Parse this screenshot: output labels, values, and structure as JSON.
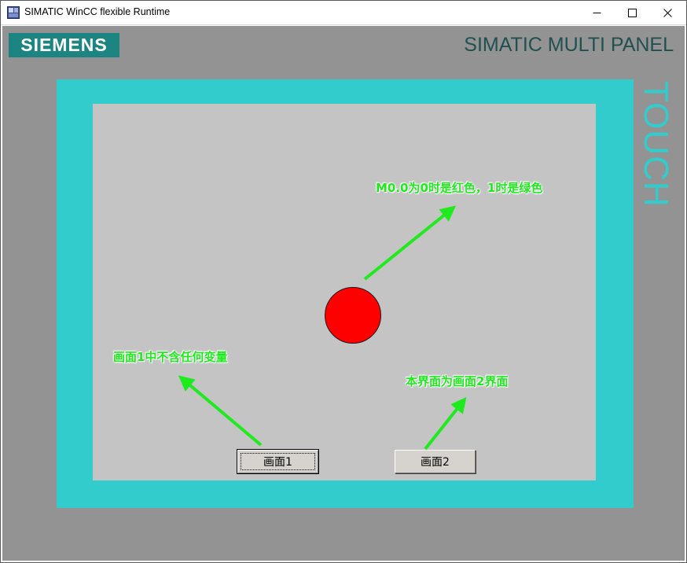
{
  "window": {
    "title": "SIMATIC WinCC flexible Runtime",
    "controls": [
      "minimize-icon",
      "maximize-icon",
      "close-icon"
    ]
  },
  "panel": {
    "brand": "SIEMENS",
    "model": "SIMATIC MULTI PANEL",
    "side_label": "TOUCH",
    "colors": {
      "bezel": "#939393",
      "frame": "#33cccc",
      "screen": "#c4c4c4",
      "logo": "#1c8582"
    }
  },
  "screen": {
    "indicator": {
      "state_color": "#ff0000"
    },
    "buttons": [
      {
        "label": "画面1"
      },
      {
        "label": "画面2"
      }
    ],
    "annotations": {
      "color_note": "M0.0为0时是红色，1时是绿色",
      "screen1_note": "画面1中不含任何变量",
      "current_note": "本界面为画面2界面",
      "color": "#1eea1e"
    }
  }
}
